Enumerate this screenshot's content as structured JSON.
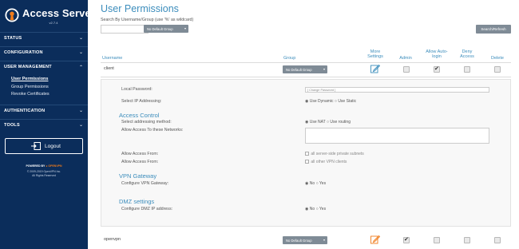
{
  "sidebar": {
    "brand": "Access Server",
    "version": "v2.7.4",
    "sections": [
      "STATUS",
      "CONFIGURATION",
      "USER MANAGEMENT",
      "AUTHENTICATION",
      "TOOLS"
    ],
    "user_mgmt_items": [
      "User Permissions",
      "Group Permissions",
      "Revoke Certificates"
    ],
    "logout": "Logout",
    "powered_by": "POWERED BY",
    "powered_brand": "OPENVPN",
    "copyright_1": "© 2009-2019 OpenVPN Inc.",
    "copyright_2": "All Rights Reserved"
  },
  "main": {
    "title": "User Permissions",
    "search_label": "Search By Username/Group (use '%' as wildcard)",
    "search_value": "",
    "group_filter": "No Default Group",
    "refresh": "Search/Refresh",
    "columns": {
      "username": "Username",
      "group": "Group",
      "more_settings": "More Settings",
      "admin": "Admin",
      "allow_autologin": "Allow Auto-login",
      "deny_access": "Deny Access",
      "delete": "Delete"
    },
    "rows": [
      {
        "username": "client",
        "group": "No Default Group",
        "admin": false,
        "autologin": true,
        "deny": false,
        "delete": false
      },
      {
        "username": "openvpn",
        "group": "No Default Group",
        "admin": true,
        "autologin": false,
        "deny": false,
        "delete": false
      }
    ]
  },
  "detail": {
    "local_password_label": "Local Password:",
    "local_password_placeholder": "[ Change Password ]",
    "select_ip_label": "Select IP Addressing:",
    "ip_option_1": "Use Dynamic",
    "ip_option_2": "Use Static",
    "access_control": "Access Control",
    "addr_method_label": "Select addressing method:",
    "addr_option_1": "Use NAT",
    "addr_option_2": "Use routing",
    "allow_access_networks_label": "Allow Access To these Networks:",
    "allow_access_from_label": "Allow Access From:",
    "subnets_option": "all server-side private subnets",
    "clients_option": "all other VPN clients",
    "vpn_gateway": "VPN Gateway",
    "configure_gateway_label": "Configure VPN Gateway:",
    "dmz_settings": "DMZ settings",
    "configure_dmz_label": "Configure DMZ IP address:",
    "no": "No",
    "yes": "Yes"
  }
}
